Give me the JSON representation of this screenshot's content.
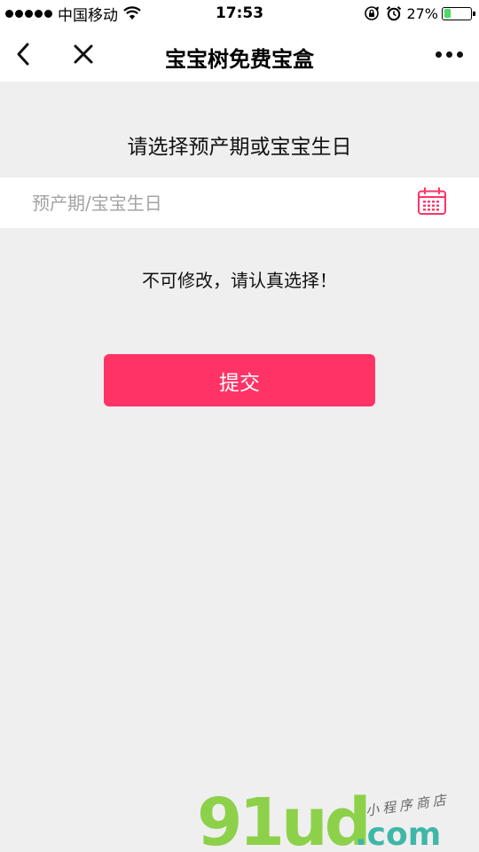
{
  "status_bar": {
    "carrier": "中国移动",
    "time": "17:53",
    "battery_percent": "27%",
    "battery_level": 0.27,
    "icons": [
      "signal-dots-icon",
      "wifi-icon",
      "orientation-lock-icon",
      "alarm-icon",
      "battery-icon"
    ]
  },
  "nav": {
    "title": "宝宝树免费宝盒",
    "icons": [
      "back-chevron-icon",
      "close-icon",
      "more-dots-icon"
    ]
  },
  "form": {
    "prompt": "请选择预产期或宝宝生日",
    "date_placeholder": "预产期/宝宝生日",
    "date_value": "",
    "calendar_icon": "calendar-icon",
    "warning": "不可修改，请认真选择！",
    "submit_label": "提交"
  },
  "watermark": {
    "logo_text": "91ud",
    "domain_text": ".com",
    "tagline": "小程序商店"
  },
  "colors": {
    "accent": "#ff3366",
    "background": "#efefef",
    "bar_background": "#ffffff",
    "battery_fill": "#4cd964",
    "placeholder": "#a3a3a3",
    "watermark_green": "#8dd14a",
    "watermark_teal": "#3fb7a8"
  }
}
